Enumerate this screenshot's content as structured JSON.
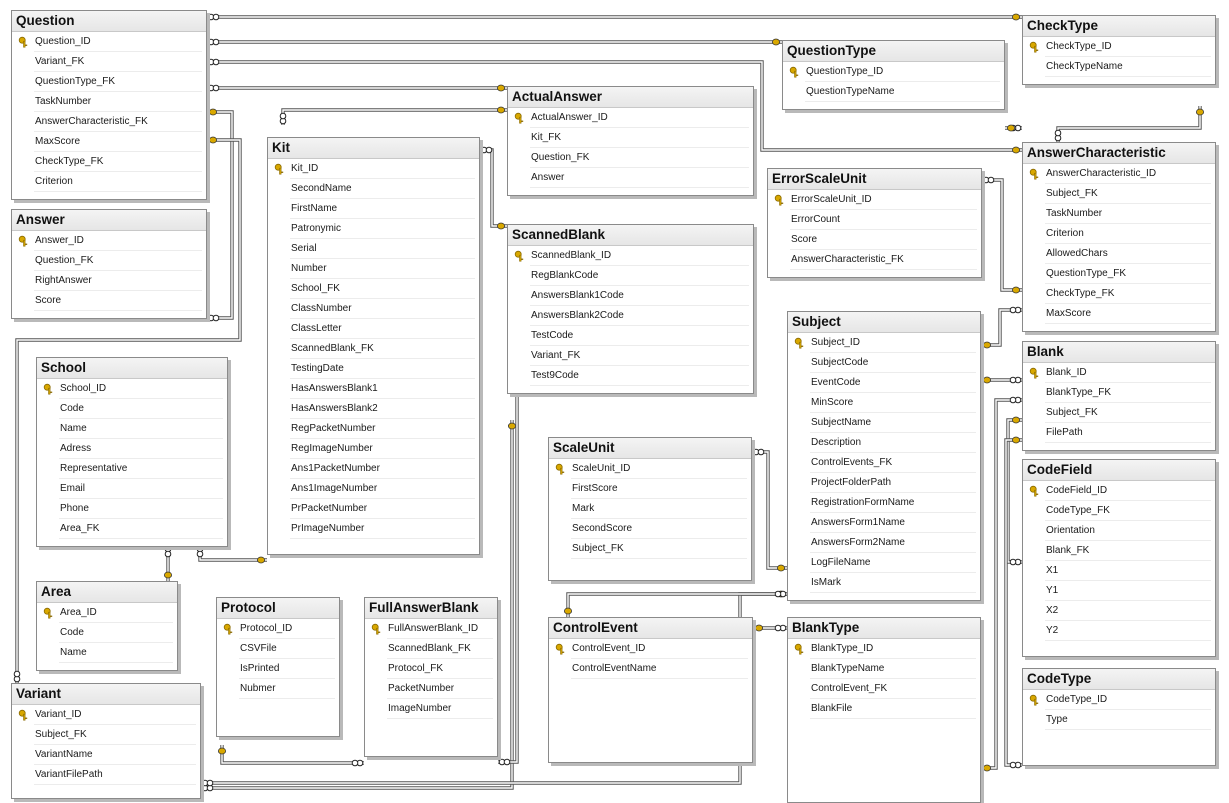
{
  "diagram": {
    "tables": [
      {
        "id": "question",
        "name": "Question",
        "columns": [
          "Question_ID",
          "Variant_FK",
          "QuestionType_FK",
          "TaskNumber",
          "AnswerCharacteristic_FK",
          "MaxScore",
          "CheckType_FK",
          "Criterion"
        ],
        "keys": [
          0
        ]
      },
      {
        "id": "answer",
        "name": "Answer",
        "columns": [
          "Answer_ID",
          "Question_FK",
          "RightAnswer",
          "Score"
        ],
        "keys": [
          0
        ]
      },
      {
        "id": "school",
        "name": "School",
        "columns": [
          "School_ID",
          "Code",
          "Name",
          "Adress",
          "Representative",
          "Email",
          "Phone",
          "Area_FK"
        ],
        "keys": [
          0
        ]
      },
      {
        "id": "area",
        "name": "Area",
        "columns": [
          "Area_ID",
          "Code",
          "Name"
        ],
        "keys": [
          0
        ]
      },
      {
        "id": "variant",
        "name": "Variant",
        "columns": [
          "Variant_ID",
          "Subject_FK",
          "VariantName",
          "VariantFilePath"
        ],
        "keys": [
          0
        ]
      },
      {
        "id": "kit",
        "name": "Kit",
        "columns": [
          "Kit_ID",
          "SecondName",
          "FirstName",
          "Patronymic",
          "Serial",
          "Number",
          "School_FK",
          "ClassNumber",
          "ClassLetter",
          "ScannedBlank_FK",
          "TestingDate",
          "HasAnswersBlank1",
          "HasAnswersBlank2",
          "RegPacketNumber",
          "RegImageNumber",
          "Ans1PacketNumber",
          "Ans1ImageNumber",
          "PrPacketNumber",
          "PrImageNumber"
        ],
        "keys": [
          0
        ]
      },
      {
        "id": "protocol",
        "name": "Protocol",
        "columns": [
          "Protocol_ID",
          "CSVFile",
          "IsPrinted",
          "Nubmer"
        ],
        "keys": [
          0
        ]
      },
      {
        "id": "fullanswerblank",
        "name": "FullAnswerBlank",
        "columns": [
          "FullAnswerBlank_ID",
          "ScannedBlank_FK",
          "Protocol_FK",
          "PacketNumber",
          "ImageNumber"
        ],
        "keys": [
          0
        ]
      },
      {
        "id": "actualanswer",
        "name": "ActualAnswer",
        "columns": [
          "ActualAnswer_ID",
          "Kit_FK",
          "Question_FK",
          "Answer"
        ],
        "keys": [
          0
        ]
      },
      {
        "id": "scannedblank",
        "name": "ScannedBlank",
        "columns": [
          "ScannedBlank_ID",
          "RegBlankCode",
          "AnswersBlank1Code",
          "AnswersBlank2Code",
          "TestCode",
          "Variant_FK",
          "Test9Code"
        ],
        "keys": [
          0
        ]
      },
      {
        "id": "scaleunit",
        "name": "ScaleUnit",
        "columns": [
          "ScaleUnit_ID",
          "FirstScore",
          "Mark",
          "SecondScore",
          "Subject_FK"
        ],
        "keys": [
          0
        ]
      },
      {
        "id": "controlevent",
        "name": "ControlEvent",
        "columns": [
          "ControlEvent_ID",
          "ControlEventName"
        ],
        "keys": [
          0
        ]
      },
      {
        "id": "questiontype",
        "name": "QuestionType",
        "columns": [
          "QuestionType_ID",
          "QuestionTypeName"
        ],
        "keys": [
          0
        ]
      },
      {
        "id": "errorscaleunit",
        "name": "ErrorScaleUnit",
        "columns": [
          "ErrorScaleUnit_ID",
          "ErrorCount",
          "Score",
          "AnswerCharacteristic_FK"
        ],
        "keys": [
          0
        ]
      },
      {
        "id": "subject",
        "name": "Subject",
        "columns": [
          "Subject_ID",
          "SubjectCode",
          "EventCode",
          "MinScore",
          "SubjectName",
          "Description",
          "ControlEvents_FK",
          "ProjectFolderPath",
          "RegistrationFormName",
          "AnswersForm1Name",
          "AnswersForm2Name",
          "LogFileName",
          "IsMark"
        ],
        "keys": [
          0
        ]
      },
      {
        "id": "blanktype",
        "name": "BlankType",
        "columns": [
          "BlankType_ID",
          "BlankTypeName",
          "ControlEvent_FK",
          "BlankFile"
        ],
        "keys": [
          0
        ]
      },
      {
        "id": "checktype",
        "name": "CheckType",
        "columns": [
          "CheckType_ID",
          "CheckTypeName"
        ],
        "keys": [
          0
        ]
      },
      {
        "id": "answercharacteristic",
        "name": "AnswerCharacteristic",
        "columns": [
          "AnswerCharacteristic_ID",
          "Subject_FK",
          "TaskNumber",
          "Criterion",
          "AllowedChars",
          "QuestionType_FK",
          "CheckType_FK",
          "MaxScore"
        ],
        "keys": [
          0
        ]
      },
      {
        "id": "blank",
        "name": "Blank",
        "columns": [
          "Blank_ID",
          "BlankType_FK",
          "Subject_FK",
          "FilePath"
        ],
        "keys": [
          0
        ]
      },
      {
        "id": "codefield",
        "name": "CodeField",
        "columns": [
          "CodeField_ID",
          "CodeType_FK",
          "Orientation",
          "Blank_FK",
          "X1",
          "Y1",
          "X2",
          "Y2"
        ],
        "keys": [
          0
        ]
      },
      {
        "id": "codetype",
        "name": "CodeType",
        "columns": [
          "CodeType_ID",
          "Type"
        ],
        "keys": [
          0
        ]
      }
    ],
    "relationships": [
      {
        "from": "question",
        "to": "checktype"
      },
      {
        "from": "question",
        "to": "questiontype"
      },
      {
        "from": "question",
        "to": "answercharacteristic"
      },
      {
        "from": "question",
        "to": "actualanswer"
      },
      {
        "from": "answer",
        "to": "question"
      },
      {
        "from": "school",
        "to": "area"
      },
      {
        "from": "kit",
        "to": "school"
      },
      {
        "from": "kit",
        "to": "actualanswer"
      },
      {
        "from": "kit",
        "to": "scannedblank"
      },
      {
        "from": "variant",
        "to": "question"
      },
      {
        "from": "variant",
        "to": "scannedblank"
      },
      {
        "from": "variant",
        "to": "subject"
      },
      {
        "from": "fullanswerblank",
        "to": "protocol"
      },
      {
        "from": "fullanswerblank",
        "to": "scannedblank"
      },
      {
        "from": "scaleunit",
        "to": "subject"
      },
      {
        "from": "errorscaleunit",
        "to": "answercharacteristic"
      },
      {
        "from": "answercharacteristic",
        "to": "subject"
      },
      {
        "from": "answercharacteristic",
        "to": "checktype"
      },
      {
        "from": "answercharacteristic",
        "to": "questiontype"
      },
      {
        "from": "blank",
        "to": "subject"
      },
      {
        "from": "blank",
        "to": "blanktype"
      },
      {
        "from": "blanktype",
        "to": "controlevent"
      },
      {
        "from": "subject",
        "to": "controlevent"
      },
      {
        "from": "codefield",
        "to": "blank"
      },
      {
        "from": "codefield",
        "to": "codetype"
      }
    ],
    "colors": {
      "key": "#d9a800",
      "line": "#555555",
      "header": "#e9e9e9",
      "shadow": "#b9b9b9"
    }
  }
}
